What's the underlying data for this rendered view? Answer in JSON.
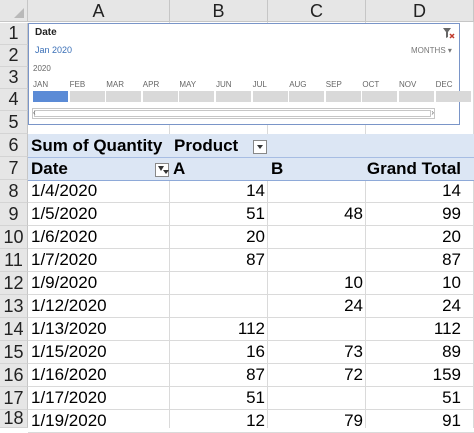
{
  "columns": [
    "A",
    "B",
    "C",
    "D"
  ],
  "rows": [
    "1",
    "2",
    "3",
    "4",
    "5",
    "6",
    "7",
    "8",
    "9",
    "10",
    "11",
    "12",
    "13",
    "14",
    "15",
    "16",
    "17",
    "18"
  ],
  "slicer": {
    "title": "Date",
    "selection": "Jan 2020",
    "level": "MONTHS",
    "year": "2020",
    "months": [
      "JAN",
      "FEB",
      "MAR",
      "APR",
      "MAY",
      "JUN",
      "JUL",
      "AUG",
      "SEP",
      "OCT",
      "NOV",
      "DEC"
    ],
    "selected_month": "JAN"
  },
  "pivot": {
    "value_field": "Sum of Quantity",
    "column_field": "Product",
    "row_field": "Date",
    "col_A": "A",
    "col_B": "B",
    "grand_total": "Grand Total",
    "data": [
      {
        "date": "1/4/2020",
        "a": "14",
        "b": "",
        "total": "14"
      },
      {
        "date": "1/5/2020",
        "a": "51",
        "b": "48",
        "total": "99"
      },
      {
        "date": "1/6/2020",
        "a": "20",
        "b": "",
        "total": "20"
      },
      {
        "date": "1/7/2020",
        "a": "87",
        "b": "",
        "total": "87"
      },
      {
        "date": "1/9/2020",
        "a": "",
        "b": "10",
        "total": "10"
      },
      {
        "date": "1/12/2020",
        "a": "",
        "b": "24",
        "total": "24"
      },
      {
        "date": "1/13/2020",
        "a": "112",
        "b": "",
        "total": "112"
      },
      {
        "date": "1/15/2020",
        "a": "16",
        "b": "73",
        "total": "89"
      },
      {
        "date": "1/16/2020",
        "a": "87",
        "b": "72",
        "total": "159"
      },
      {
        "date": "1/17/2020",
        "a": "51",
        "b": "",
        "total": "51"
      },
      {
        "date": "1/19/2020",
        "a": "12",
        "b": "79",
        "total": "91"
      }
    ]
  },
  "colors": {
    "slicer_selected": "#5b8bd6",
    "pivot_header": "#dce6f4",
    "slicer_border": "#7a95c8"
  }
}
